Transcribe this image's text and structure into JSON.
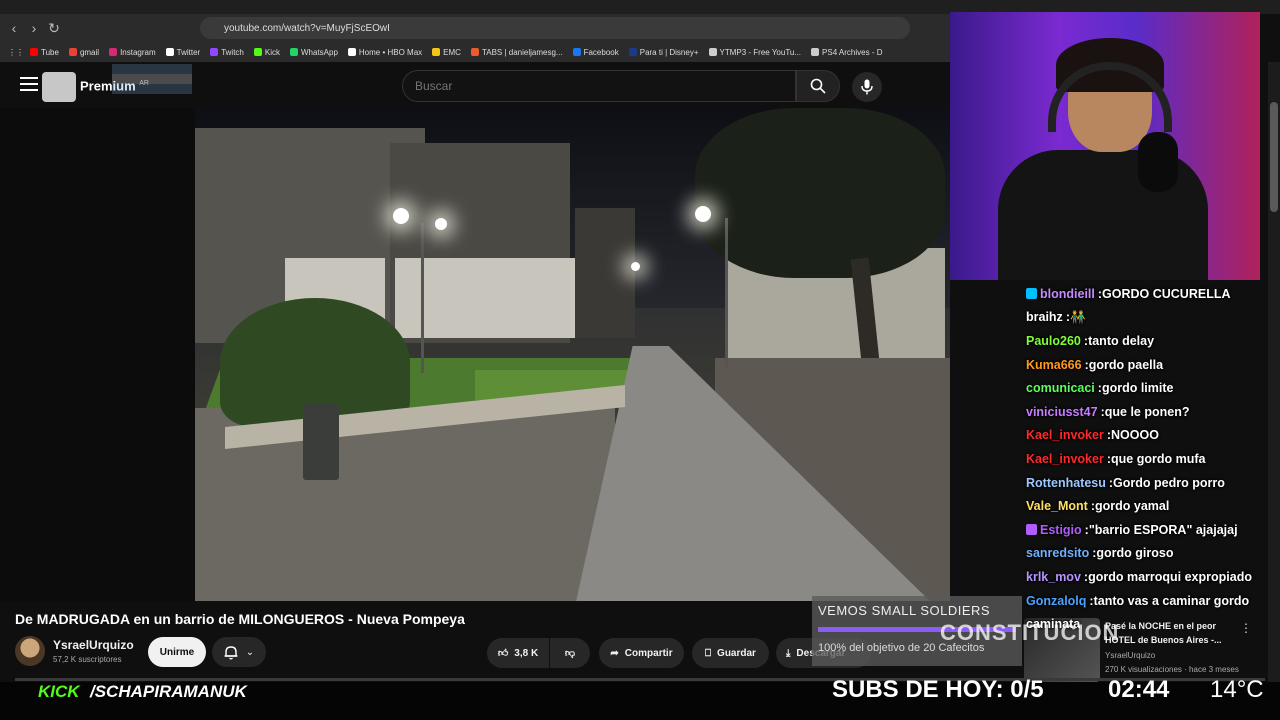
{
  "browser": {
    "url": "youtube.com/watch?v=MuyFjScEOwI",
    "bookmarks": [
      {
        "label": "Tube",
        "color": "#ff0000"
      },
      {
        "label": "gmail",
        "color": "#ea4335"
      },
      {
        "label": "Instagram",
        "color": "#d62976"
      },
      {
        "label": "Twitter",
        "color": "#ffffff"
      },
      {
        "label": "Twitch",
        "color": "#9146ff"
      },
      {
        "label": "Kick",
        "color": "#53fc18"
      },
      {
        "label": "WhatsApp",
        "color": "#25d366"
      },
      {
        "label": "Home • HBO Max",
        "color": "#ffffff"
      },
      {
        "label": "EMC",
        "color": "#f5c518"
      },
      {
        "label": "TABS | danieljamesg...",
        "color": "#e85d2a"
      },
      {
        "label": "Facebook",
        "color": "#1877f2"
      },
      {
        "label": "Para ti | Disney+",
        "color": "#1b3b8a"
      },
      {
        "label": "YTMP3 - Free YouTu...",
        "color": "#cccccc"
      },
      {
        "label": "PS4 Archives - D",
        "color": "#cccccc"
      }
    ]
  },
  "header": {
    "logo_text": "Premium",
    "country": "AR",
    "search_placeholder": "Buscar"
  },
  "video": {
    "title": "De MADRUGADA en un barrio de MILONGUEROS - Nueva Pompeya",
    "channel_name": "YsraelUrquizo",
    "channel_subs": "57,2 K suscriptores",
    "join_label": "Unirme",
    "like_count": "3,8 K",
    "share_label": "Compartir",
    "save_label": "Guardar",
    "download_label": "Descargar"
  },
  "recommended": {
    "title": "Pasé la NOCHE en el peor HOTEL de Buenos Aires -...",
    "channel": "YsraelUrquizo",
    "stats": "270 K visualizaciones · hace 3 meses"
  },
  "chat": [
    {
      "user": "blondieill",
      "msg": "GORDO CUCURELLA",
      "color": "#c48cff",
      "badge": "#00c0ff"
    },
    {
      "user": "braihz",
      "msg": "👬",
      "color": "#ffffff",
      "badge": ""
    },
    {
      "user": "Paulo260",
      "msg": "tanto delay",
      "color": "#7fff3a",
      "badge": ""
    },
    {
      "user": "Kuma666",
      "msg": "gordo paella",
      "color": "#ff9a1f",
      "badge": ""
    },
    {
      "user": "comunicaci",
      "msg": "gordo limite",
      "color": "#5cff5c",
      "badge": ""
    },
    {
      "user": "viniciusst47",
      "msg": "que le ponen?",
      "color": "#c77dff",
      "badge": ""
    },
    {
      "user": "Kael_invoker",
      "msg": "NOOOO",
      "color": "#ff2a2a",
      "badge": ""
    },
    {
      "user": "Kael_invoker",
      "msg": "que gordo mufa",
      "color": "#ff2a2a",
      "badge": ""
    },
    {
      "user": "Rottenhatesu",
      "msg": "Gordo pedro porro",
      "color": "#9ec8ff",
      "badge": ""
    },
    {
      "user": "Vale_Mont",
      "msg": "gordo yamal",
      "color": "#ffe066",
      "badge": ""
    },
    {
      "user": "Estigio",
      "msg": "\"barrio ESPORA\" ajajajaj",
      "color": "#b15cff",
      "badge": "#b15cff"
    },
    {
      "user": "sanredsito",
      "msg": "gordo giroso",
      "color": "#6fb0ff",
      "badge": ""
    },
    {
      "user": "krlk_mov",
      "msg": "gordo marroqui expropiado",
      "color": "#b794ff",
      "badge": ""
    },
    {
      "user": "Gonzalolq",
      "msg": "tanto vas a caminar gordo",
      "color": "#4aa3ff",
      "badge": ""
    },
    {
      "user": "",
      "msg": "caminata",
      "color": "#ffffff",
      "badge": ""
    }
  ],
  "goal": {
    "title": "VEMOS SMALL SOLDIERS",
    "text": "100% del objetivo de 20 Cafecitos",
    "progress": 1.0
  },
  "overlay_text": "CONSTITUCION",
  "stream_bar": {
    "platform": "KICK",
    "handle": "/SCHAPIRAMANUK",
    "subs_today": "SUBS DE HOY: 0/5",
    "time": "02:44",
    "temperature": "14°C"
  }
}
